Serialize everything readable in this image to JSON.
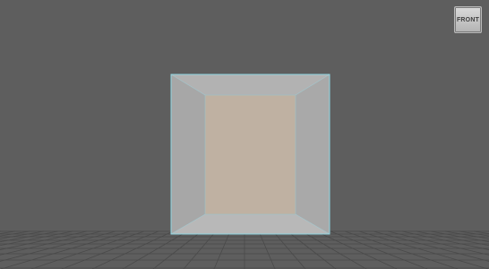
{
  "viewport": {
    "background": "#5e5e5e",
    "grid_color": "#4a4a4a",
    "object_edge_color": "#7fd4e0"
  },
  "viewcube": {
    "face_label": "FRONT",
    "icon": "view-cube-icon"
  },
  "object": {
    "outer_face_color": "#aaaaaa",
    "inner_face_color": "#bfb0a0"
  }
}
